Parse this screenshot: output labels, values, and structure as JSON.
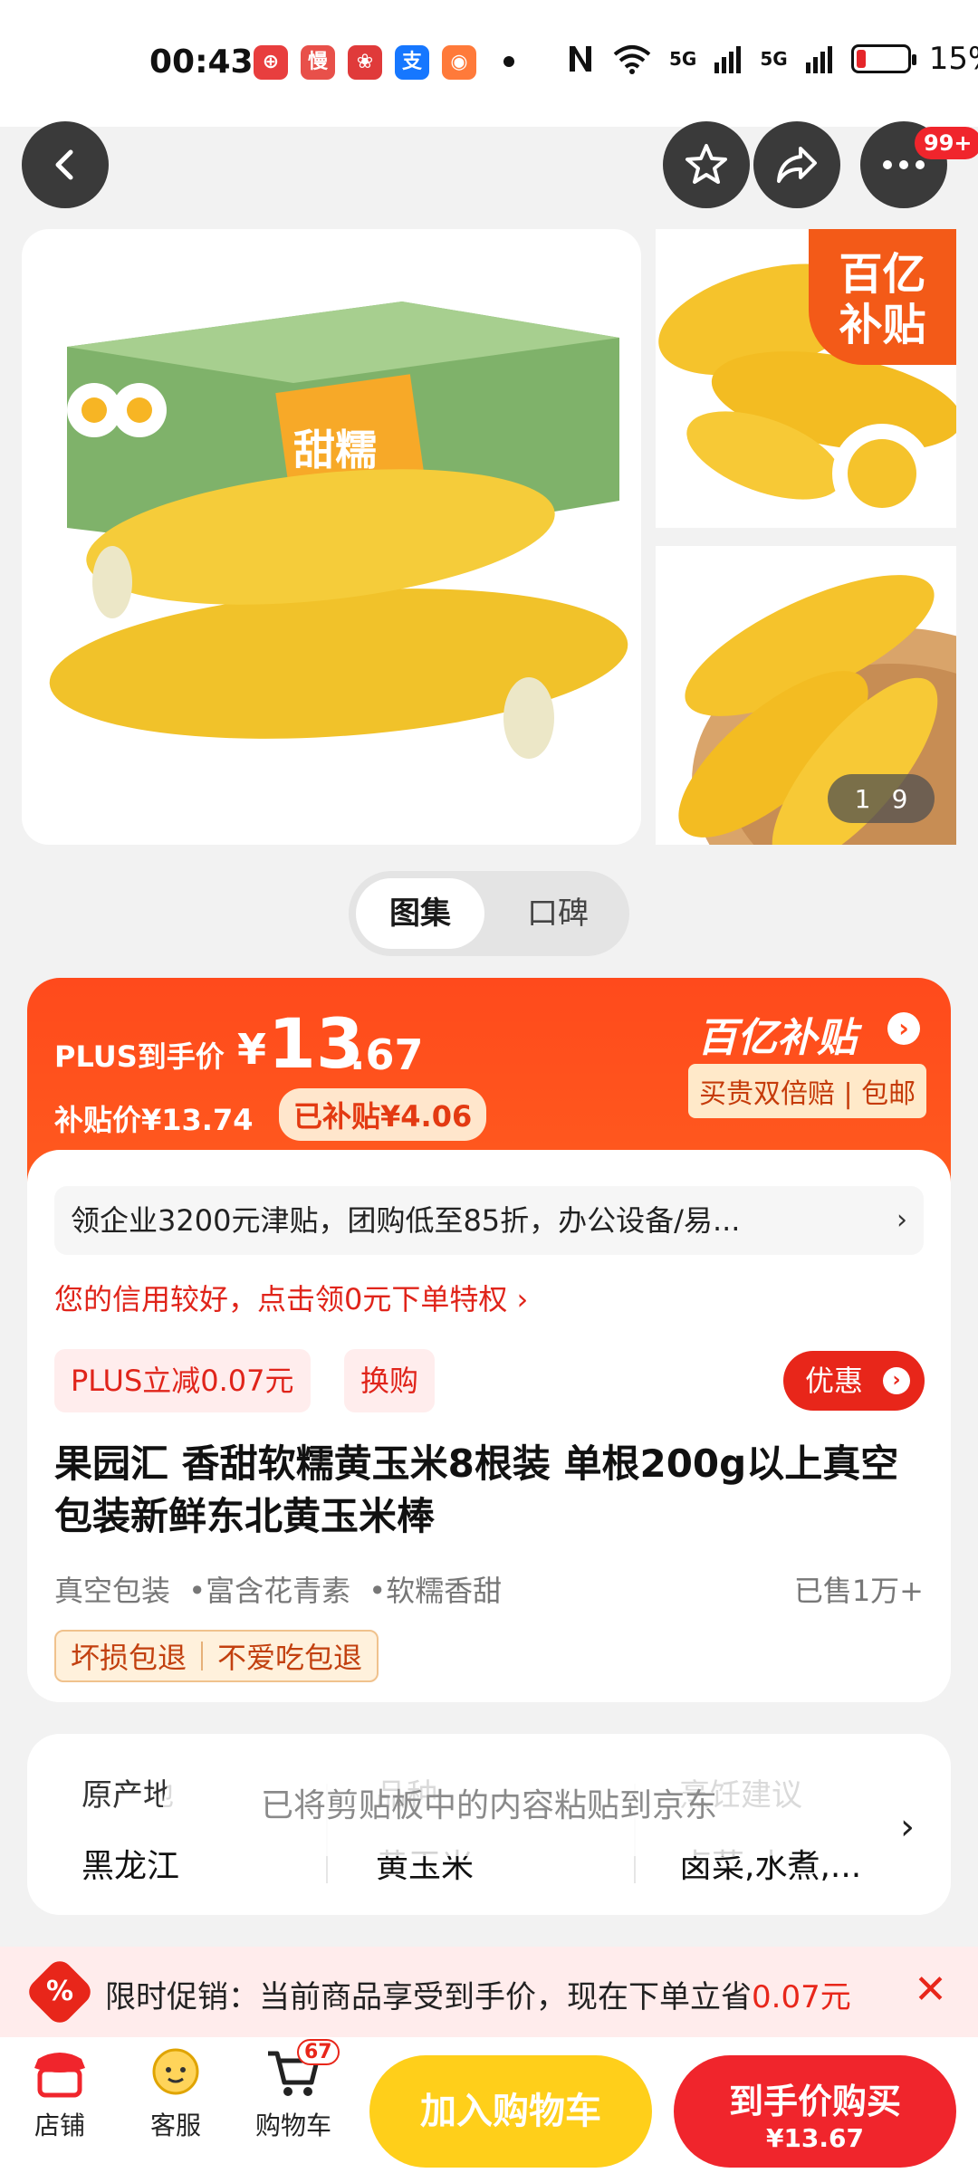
{
  "status_bar": {
    "time": "00:43",
    "battery": "15%",
    "signal1": "5G",
    "signal2": "5G",
    "battery_level": 0.15
  },
  "top_nav": {
    "more_badge": "99+"
  },
  "gallery": {
    "subsidy_badge_line1": "百亿",
    "subsidy_badge_line2": "补贴",
    "counter_current": "1",
    "counter_total": "9",
    "box_text": "甜糯黄玉米"
  },
  "tabs": {
    "active": "图集",
    "other": "口碑"
  },
  "price": {
    "plus_label": "PLUS到手价",
    "yen": "¥",
    "int": "13",
    "dec": ".67",
    "subsidy_label": "补贴价¥13.74",
    "subsidy_saved": "已补贴¥4.06",
    "yi_badge": "百亿补贴",
    "guarantee": "买贵双倍赔 | 包邮"
  },
  "info": {
    "promo_bar": "领企业3200元津贴，团购低至85折，办公设备/易...",
    "credit_line": "您的信用较好，点击领0元下单特权 ›",
    "tag_plus": "PLUS立减0.07元",
    "tag_swap": "换购",
    "coupon_btn": "优惠",
    "title": "果园汇 香甜软糯黄玉米8根装 单根200g以上真空包装新鲜东北黄玉米棒",
    "features": [
      "真空包装",
      "•富含花青素",
      "•软糯香甜"
    ],
    "sold": "已售1万+",
    "service": [
      "坏损包退",
      "不爱吃包退"
    ]
  },
  "attributes": [
    {
      "key": "原产地",
      "value": "黑龙江"
    },
    {
      "key": "品种",
      "value": "黄玉米"
    },
    {
      "key": "烹饪建议",
      "value": "卤菜,水煮,..."
    }
  ],
  "toast": "已将剪贴板中的内容粘贴到京东",
  "limited": {
    "text_prefix": "限时促销：当前商品享受到手价，现在下单立省",
    "text_amount": "0.07元",
    "close": "✕"
  },
  "bottom_bar": {
    "store": "店铺",
    "service": "客服",
    "cart": "购物车",
    "cart_count": "67",
    "add_cart": "加入购物车",
    "buy_line1": "到手价购买",
    "buy_line2": "¥13.67"
  },
  "colors": {
    "brand_red": "#f0252c",
    "subsidy_orange": "#ff4a1c",
    "cart_yellow": "#ffcf1a"
  }
}
